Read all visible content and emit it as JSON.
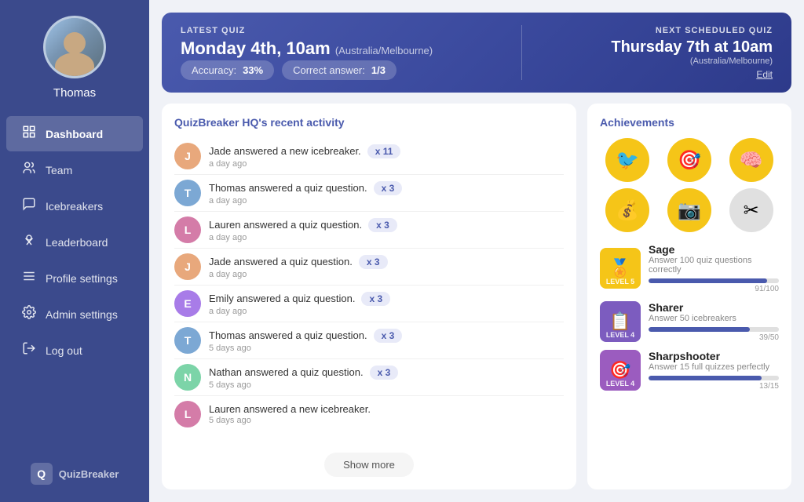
{
  "sidebar": {
    "username": "Thomas",
    "nav": [
      {
        "id": "dashboard",
        "label": "Dashboard",
        "icon": "⊞",
        "active": true
      },
      {
        "id": "team",
        "label": "Team",
        "icon": "👥",
        "active": false
      },
      {
        "id": "icebreakers",
        "label": "Icebreakers",
        "icon": "💬",
        "active": false
      },
      {
        "id": "leaderboard",
        "label": "Leaderboard",
        "icon": "🏆",
        "active": false
      },
      {
        "id": "profile-settings",
        "label": "Profile settings",
        "icon": "☰",
        "active": false
      },
      {
        "id": "admin-settings",
        "label": "Admin settings",
        "icon": "⚙",
        "active": false
      },
      {
        "id": "log-out",
        "label": "Log out",
        "icon": "⏻",
        "active": false
      }
    ],
    "logo_text": "QuizBreaker"
  },
  "quiz_banner": {
    "latest_label": "LATEST QUIZ",
    "latest_date": "Monday 4th, 10am",
    "latest_timezone": "(Australia/Melbourne)",
    "accuracy_label": "Accuracy:",
    "accuracy_value": "33%",
    "correct_label": "Correct answer:",
    "correct_value": "1/3",
    "next_label": "NEXT SCHEDULED QUIZ",
    "next_date": "Thursday 7th at 10am",
    "next_timezone": "(Australia/Melbourne)",
    "edit_label": "Edit"
  },
  "activity": {
    "title": "QuizBreaker HQ's recent activity",
    "items": [
      {
        "name": "Jade",
        "text": "Jade answered a new icebreaker.",
        "time": "a day ago",
        "points": "x 11",
        "color": "#e8a87c"
      },
      {
        "name": "Thomas",
        "text": "Thomas answered a quiz question.",
        "time": "a day ago",
        "points": "x 3",
        "color": "#7ca8d4"
      },
      {
        "name": "Lauren",
        "text": "Lauren answered a quiz question.",
        "time": "a day ago",
        "points": "x 3",
        "color": "#d47ca8"
      },
      {
        "name": "Jade",
        "text": "Jade answered a quiz question.",
        "time": "a day ago",
        "points": "x 3",
        "color": "#e8a87c"
      },
      {
        "name": "Emily",
        "text": "Emily answered a quiz question.",
        "time": "a day ago",
        "points": "x 3",
        "color": "#a87ce8"
      },
      {
        "name": "Thomas",
        "text": "Thomas answered a quiz question.",
        "time": "5 days ago",
        "points": "x 3",
        "color": "#7ca8d4"
      },
      {
        "name": "Nathan",
        "text": "Nathan answered a quiz question.",
        "time": "5 days ago",
        "points": "x 3",
        "color": "#7cd4a8"
      },
      {
        "name": "Lauren",
        "text": "Lauren answered a new icebreaker.",
        "time": "5 days ago",
        "points": "",
        "color": "#d47ca8"
      }
    ],
    "show_more": "Show more"
  },
  "achievements": {
    "title": "Achievements",
    "badges": [
      {
        "icon": "🐦",
        "active": true
      },
      {
        "icon": "🎯",
        "active": true
      },
      {
        "icon": "🧠",
        "active": true
      },
      {
        "icon": "💰",
        "active": true
      },
      {
        "icon": "📷",
        "active": true
      },
      {
        "icon": "✂",
        "active": false
      }
    ],
    "levels": [
      {
        "title": "Sage",
        "desc": "Answer 100 quiz questions correctly",
        "level": "LEVEL 5",
        "badge_type": "gold",
        "badge_icon": "🏅",
        "progress": 91,
        "total": 100,
        "progress_text": "91/100"
      },
      {
        "title": "Sharer",
        "desc": "Answer 50 icebreakers",
        "level": "LEVEL 4",
        "badge_type": "purple",
        "badge_icon": "📋",
        "progress": 78,
        "total": 100,
        "progress_text": "39/50"
      },
      {
        "title": "Sharpshooter",
        "desc": "Answer 15 full quizzes perfectly",
        "level": "LEVEL 4",
        "badge_type": "purple2",
        "badge_icon": "🎯",
        "progress": 87,
        "total": 100,
        "progress_text": "13/15"
      }
    ]
  }
}
